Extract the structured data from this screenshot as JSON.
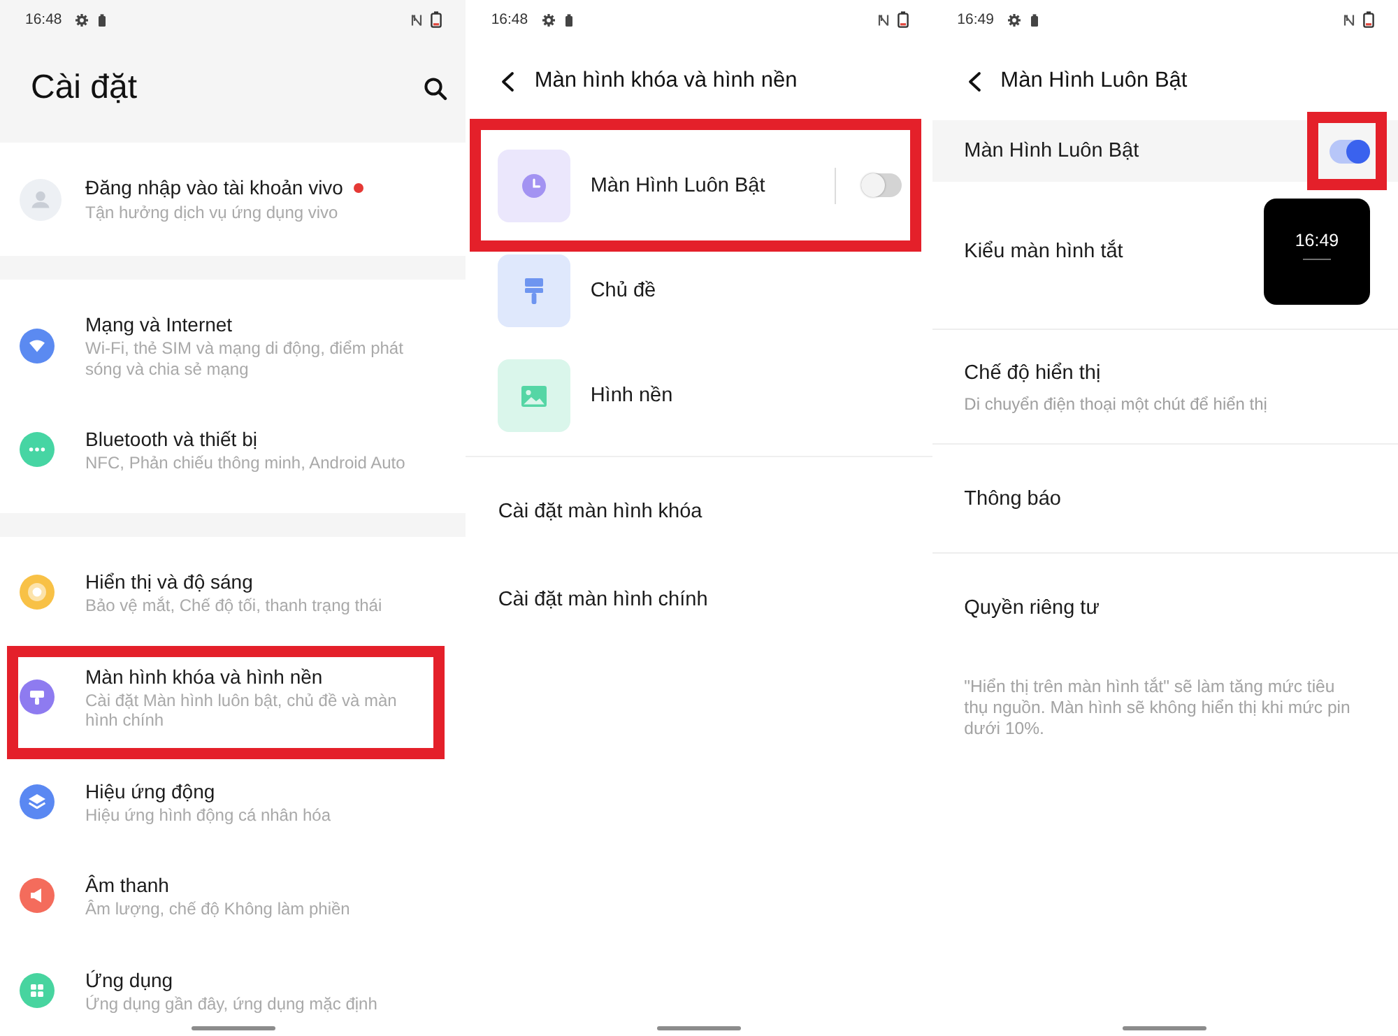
{
  "screens": [
    {
      "kind": "main",
      "status_bar": {
        "time": "16:48"
      },
      "title": "Cài đặt",
      "account": {
        "title": "Đăng nhập vào tài khoản vivo",
        "subtitle": "Tận hưởng dịch vụ ứng dụng vivo",
        "new_dot": true
      },
      "groups": [
        [
          {
            "title": "Mạng và Internet",
            "subtitle": "Wi-Fi, thẻ SIM và mạng di động, điểm phát sóng và chia sẻ mạng",
            "color": "#5b8af1",
            "highlighted": false
          },
          {
            "title": "Bluetooth và thiết bị",
            "subtitle": "NFC, Phản chiếu thông minh, Android Auto",
            "color": "#46d5a3",
            "highlighted": false
          }
        ],
        [
          {
            "title": "Hiển thị và độ sáng",
            "subtitle": "Bảo vệ mắt, Chế độ tối, thanh trạng thái",
            "color": "#f8c146",
            "highlighted": false
          },
          {
            "title": "Màn hình khóa và hình nền",
            "subtitle": "Cài đặt Màn hình luôn bật, chủ đề và màn hình chính",
            "color": "#8e7bf0",
            "highlighted": true
          },
          {
            "title": "Hiệu ứng động",
            "subtitle": "Hiệu ứng hình động cá nhân hóa",
            "color": "#5a88f2",
            "highlighted": false
          },
          {
            "title": "Âm thanh",
            "subtitle": "Âm lượng, chế độ Không làm phiền",
            "color": "#f46c5c",
            "highlighted": false
          },
          {
            "title": "Ứng dụng",
            "subtitle": "Ứng dụng gần đây, ứng dụng mặc định",
            "color": "#47d49f",
            "highlighted": false
          }
        ]
      ]
    },
    {
      "kind": "submenu",
      "status_bar": {
        "time": "16:48"
      },
      "title": "Màn hình khóa và hình nền",
      "tiles": [
        {
          "title": "Màn Hình Luôn Bật",
          "color": "#a393f2",
          "highlighted": true,
          "switch": {
            "on": false
          }
        },
        {
          "title": "Chủ đề",
          "color": "#6e95f0",
          "highlighted": false
        },
        {
          "title": "Hình nền",
          "color": "#55d6a5",
          "highlighted": false
        }
      ],
      "links": [
        {
          "title": "Cài đặt màn hình khóa"
        },
        {
          "title": "Cài đặt màn hình chính"
        }
      ]
    },
    {
      "kind": "detail",
      "status_bar": {
        "time": "16:49"
      },
      "title": "Màn Hình Luôn Bật",
      "rows": [
        {
          "kind": "switch",
          "title": "Màn Hình Luôn Bật",
          "on": true,
          "highlighted": true
        },
        {
          "kind": "preview",
          "title": "Kiểu màn hình tắt",
          "preview_time": "16:49",
          "highlighted": false
        },
        {
          "kind": "link",
          "title": "Chế độ hiển thị",
          "subtitle": "Di chuyển điện thoại một chút để hiển thị",
          "highlighted": false
        },
        {
          "kind": "link",
          "title": "Thông báo",
          "highlighted": false
        },
        {
          "kind": "link",
          "title": "Quyền riêng tư",
          "highlighted": false
        }
      ],
      "note": "\"Hiển thị trên màn hình tắt\" sẽ làm tăng mức tiêu thụ nguồn. Màn hình sẽ không hiển thị khi mức pin dưới 10%."
    }
  ]
}
